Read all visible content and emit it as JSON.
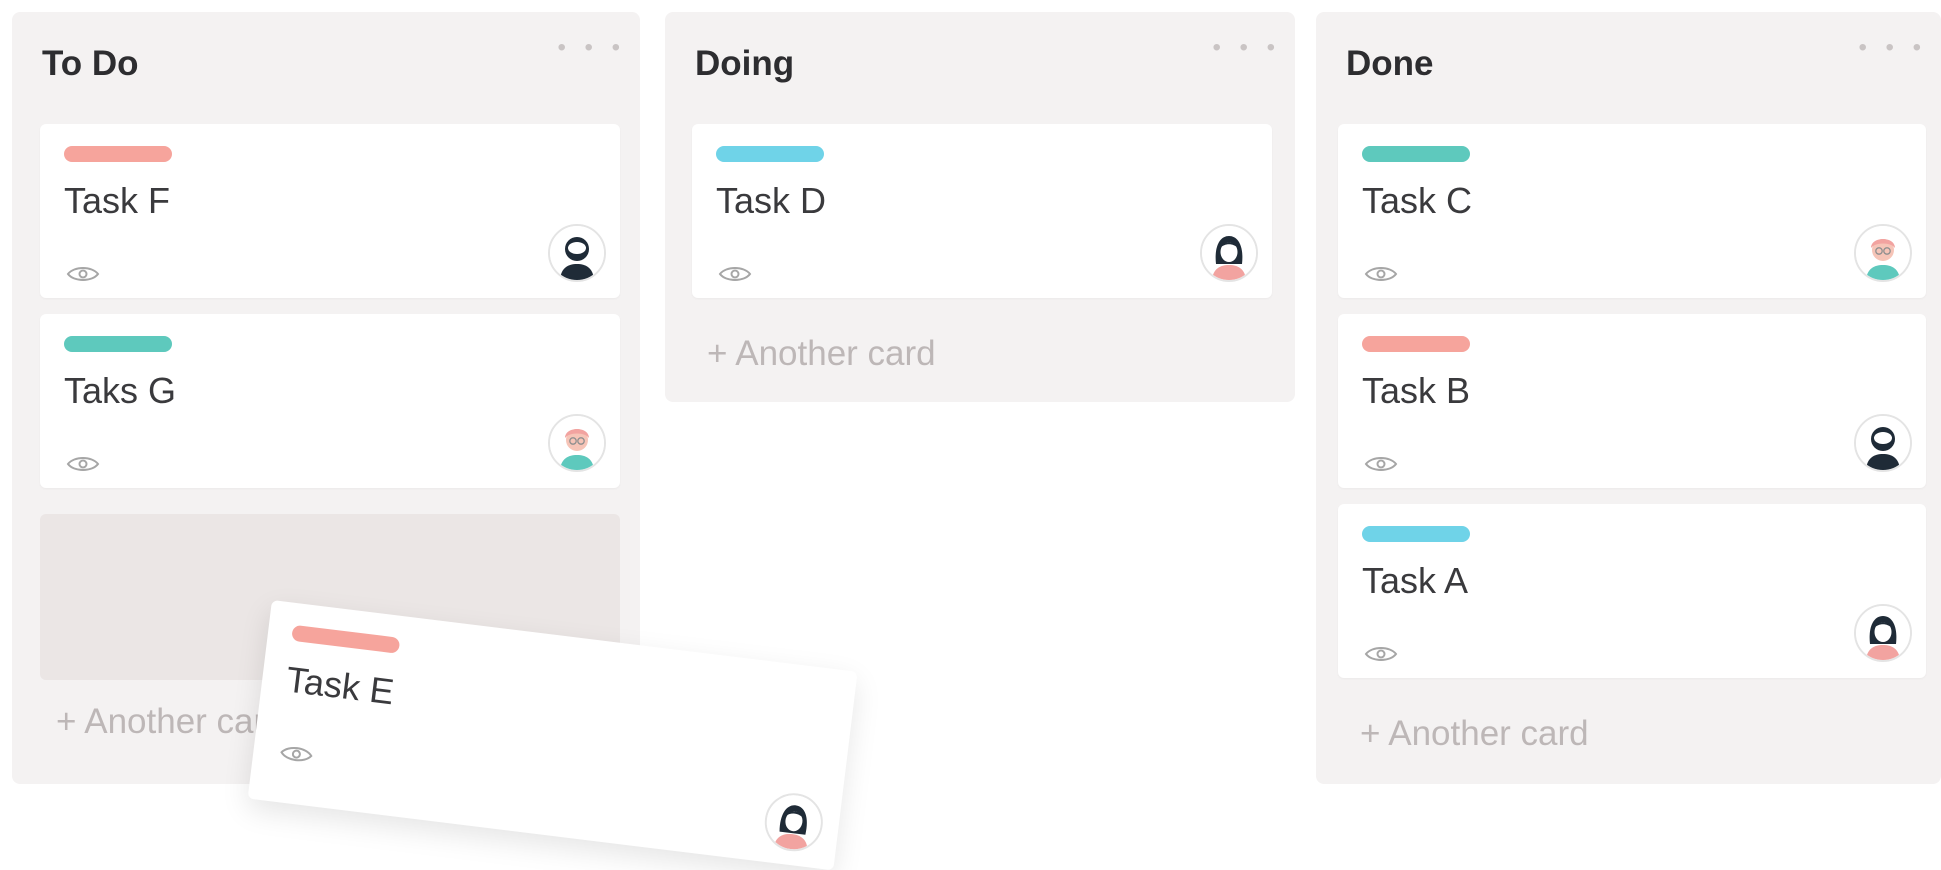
{
  "board": {
    "colors": {
      "salmon": "#f6a49c",
      "teal": "#5ec9bd",
      "blue": "#6fd3e8",
      "dark_avatar": "#1f2b37",
      "pink_avatar": "#f2a3a0"
    },
    "columns": [
      {
        "title": "To Do",
        "menu": "• • •",
        "add_label": "+ Another card",
        "cards": [
          {
            "title": "Task F",
            "label_color": "#f6a49c",
            "watch_icon": "eye-icon",
            "avatar": "avatar-bearded-man"
          },
          {
            "title": "Taks G",
            "label_color": "#5ec9bd",
            "watch_icon": "eye-icon",
            "avatar": "avatar-elderly-woman-glasses"
          }
        ]
      },
      {
        "title": "Doing",
        "menu": "• • •",
        "add_label": "+ Another card",
        "cards": [
          {
            "title": "Task D",
            "label_color": "#6fd3e8",
            "watch_icon": "eye-icon",
            "avatar": "avatar-woman-dark-hair"
          }
        ]
      },
      {
        "title": "Done",
        "menu": "• • •",
        "add_label": "+ Another card",
        "cards": [
          {
            "title": "Task C",
            "label_color": "#5ec9bd",
            "watch_icon": "eye-icon",
            "avatar": "avatar-elderly-woman-glasses"
          },
          {
            "title": "Task B",
            "label_color": "#f6a49c",
            "watch_icon": "eye-icon",
            "avatar": "avatar-bearded-man"
          },
          {
            "title": "Task A",
            "label_color": "#6fd3e8",
            "watch_icon": "eye-icon",
            "avatar": "avatar-woman-dark-hair"
          }
        ]
      }
    ],
    "dragging_card": {
      "title": "Task E",
      "label_color": "#f6a49c",
      "watch_icon": "eye-icon",
      "avatar": "avatar-woman-dark-hair"
    }
  }
}
